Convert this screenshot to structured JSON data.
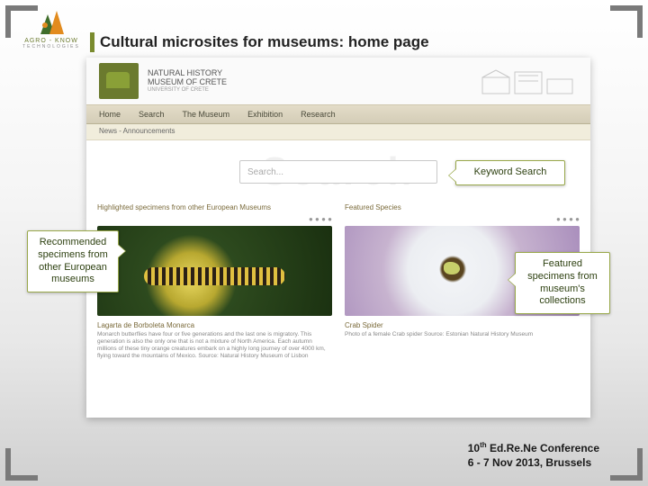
{
  "slide": {
    "project_label": "AGRO - KNOW",
    "project_sub": "TECHNOLOGIES",
    "title": "Cultural microsites for museums: home page"
  },
  "site": {
    "museum_name_line1": "NATURAL HISTORY",
    "museum_name_line2": "MUSEUM OF CRETE",
    "museum_name_line3": "UNIVERSITY OF CRETE",
    "nav": {
      "home": "Home",
      "search": "Search",
      "museum": "The Museum",
      "exhibition": "Exhibition",
      "research": "Research"
    },
    "subnav": "News - Announcements",
    "search_bg": "Search",
    "search_placeholder": "Search...",
    "left_section_title": "Highlighted specimens from other European Museums",
    "right_section_title": "Featured Species",
    "dots": "● ● ● ●",
    "left_caption_title": "Lagarta de Borboleta Monarca",
    "left_caption_text": "Monarch butterflies have four or five generations and the last one is migratory. This generation is also the only one that is not a mixture of North America. Each autumn millions of these tiny orange creatures embark on a highly long journey of over 4000 km, flying toward the mountains of Mexico.\nSource: Natural History Museum of Lisbon",
    "right_caption_title": "Crab Spider",
    "right_caption_text": "Photo of a female Crab spider\nSource: Estonian Natural History Museum"
  },
  "callouts": {
    "left": "Recommended specimens from other European museums",
    "search": "Keyword Search",
    "right": "Featured specimens from museum's collections"
  },
  "footer": {
    "line1_prefix": "10",
    "line1_ord": "th",
    "line1_rest": " Ed.Re.Ne Conference",
    "line2": "6 - 7 Nov 2013, Brussels"
  }
}
